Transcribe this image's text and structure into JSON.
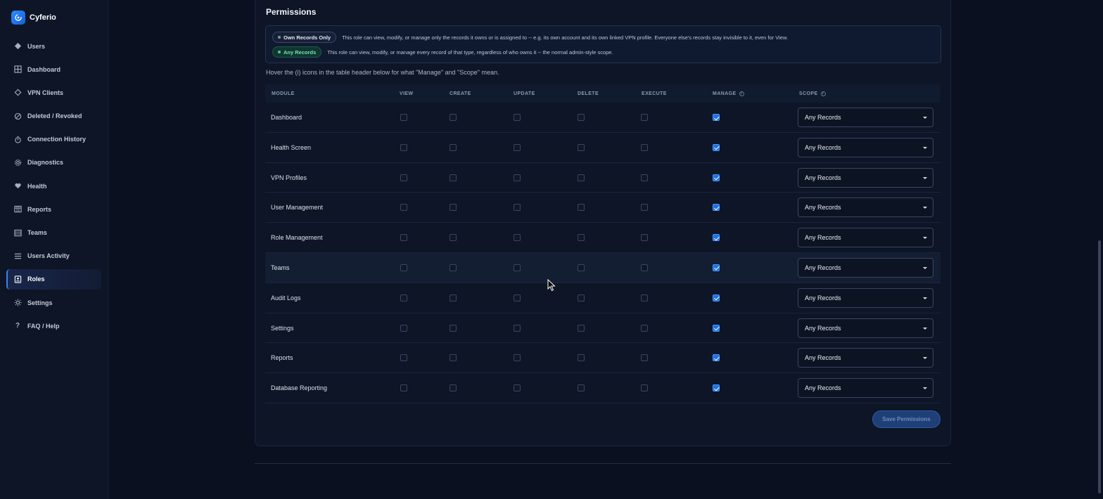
{
  "app": {
    "name": "Cyferio"
  },
  "sidebar": {
    "items": [
      {
        "label": "Users",
        "icon": "users-diamond-icon",
        "active": false
      },
      {
        "label": "Dashboard",
        "icon": "grid-icon",
        "active": false
      },
      {
        "label": "VPN Clients",
        "icon": "diamond-outline-icon",
        "active": false
      },
      {
        "label": "Deleted / Revoked",
        "icon": "ban-icon",
        "active": false
      },
      {
        "label": "Connection History",
        "icon": "stopwatch-icon",
        "active": false
      },
      {
        "label": "Diagnostics",
        "icon": "gear-icon",
        "active": false
      },
      {
        "label": "Health",
        "icon": "heart-icon",
        "active": false
      },
      {
        "label": "Reports",
        "icon": "table-icon",
        "active": false
      },
      {
        "label": "Teams",
        "icon": "list-box-icon",
        "active": false
      },
      {
        "label": "Users Activity",
        "icon": "lines-icon",
        "active": false
      },
      {
        "label": "Roles",
        "icon": "id-badge-icon",
        "active": true
      },
      {
        "label": "Settings",
        "icon": "sun-gear-icon",
        "active": false
      },
      {
        "label": "FAQ / Help",
        "icon": "question-icon",
        "active": false
      }
    ]
  },
  "permissions": {
    "title": "Permissions",
    "legend": [
      {
        "badge": "Own Records Only",
        "text": "This role can view, modify, or manage only the records it owns or is assigned to -- e.g. its own account and its own linked VPN profile. Everyone else's records stay invisible to it, even for View."
      },
      {
        "badge": "Any Records",
        "text": "This role can view, modify, or manage every record of that type, regardless of who owns it -- the normal admin-style scope."
      }
    ],
    "hint": "Hover the (i) icons in the table header below for what \"Manage\" and \"Scope\" mean.",
    "columns": {
      "module": "MODULE",
      "view": "VIEW",
      "create": "CREATE",
      "update": "UPDATE",
      "delete": "DELETE",
      "execute": "EXECUTE",
      "manage": "MANAGE",
      "scope": "SCOPE",
      "info_glyph": "i"
    },
    "rows": [
      {
        "module": "Dashboard",
        "view": false,
        "create": false,
        "update": false,
        "delete": false,
        "execute": false,
        "manage": true,
        "scope": "Any Records"
      },
      {
        "module": "Health Screen",
        "view": false,
        "create": false,
        "update": false,
        "delete": false,
        "execute": false,
        "manage": true,
        "scope": "Any Records"
      },
      {
        "module": "VPN Profiles",
        "view": false,
        "create": false,
        "update": false,
        "delete": false,
        "execute": false,
        "manage": true,
        "scope": "Any Records"
      },
      {
        "module": "User Management",
        "view": false,
        "create": false,
        "update": false,
        "delete": false,
        "execute": false,
        "manage": true,
        "scope": "Any Records"
      },
      {
        "module": "Role Management",
        "view": false,
        "create": false,
        "update": false,
        "delete": false,
        "execute": false,
        "manage": true,
        "scope": "Any Records"
      },
      {
        "module": "Teams",
        "view": false,
        "create": false,
        "update": false,
        "delete": false,
        "execute": false,
        "manage": true,
        "scope": "Any Records",
        "hovered": true
      },
      {
        "module": "Audit Logs",
        "view": false,
        "create": false,
        "update": false,
        "delete": false,
        "execute": false,
        "manage": true,
        "scope": "Any Records"
      },
      {
        "module": "Settings",
        "view": false,
        "create": false,
        "update": false,
        "delete": false,
        "execute": false,
        "manage": true,
        "scope": "Any Records"
      },
      {
        "module": "Reports",
        "view": false,
        "create": false,
        "update": false,
        "delete": false,
        "execute": false,
        "manage": true,
        "scope": "Any Records"
      },
      {
        "module": "Database Reporting",
        "view": false,
        "create": false,
        "update": false,
        "delete": false,
        "execute": false,
        "manage": true,
        "scope": "Any Records"
      }
    ],
    "save_label": "Save Permissions"
  },
  "colors": {
    "accent": "#1a73e8",
    "any_records_badge": "#6ee7b7",
    "background": "#0a1020"
  }
}
